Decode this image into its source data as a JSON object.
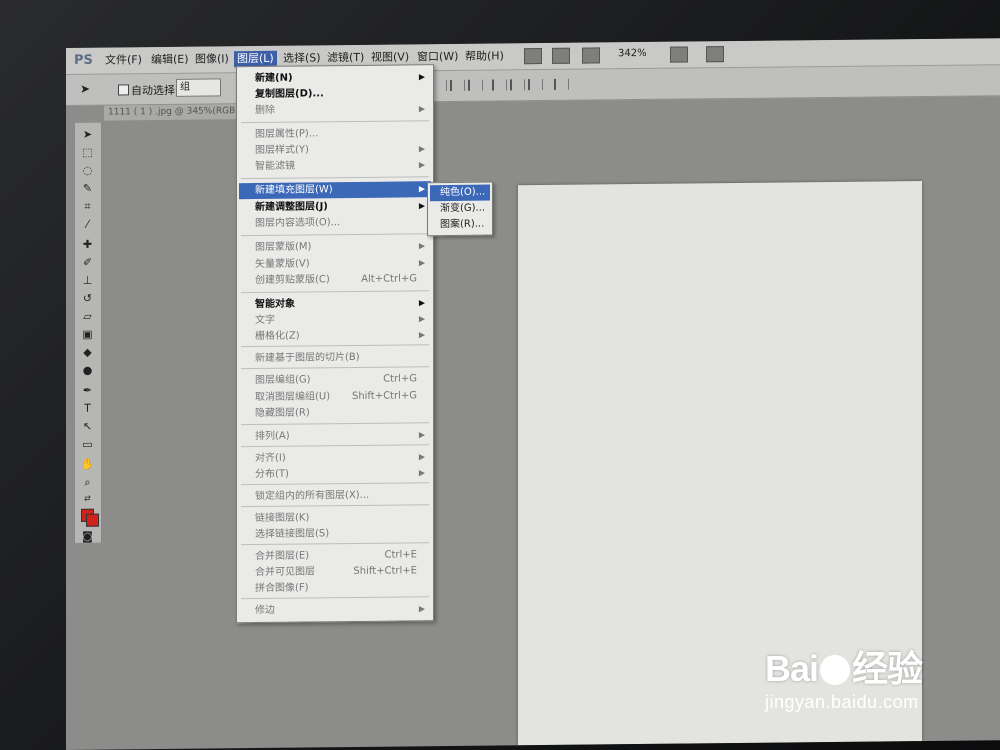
{
  "menubar": {
    "logo": "PS",
    "items": [
      "文件(F)",
      "编辑(E)",
      "图像(I)",
      "图层(L)",
      "选择(S)",
      "滤镜(T)",
      "视图(V)",
      "窗口(W)",
      "帮助(H)"
    ],
    "zoom": "342%"
  },
  "options_bar": {
    "auto_select_label": "自动选择:",
    "auto_select_value": "组"
  },
  "document_tab": "1111 ( 1 ) .jpg @ 345%(RGB",
  "layer_menu": {
    "items": [
      {
        "label": "新建(N)",
        "shortcut": "",
        "submenu": true,
        "state": "bold"
      },
      {
        "label": "复制图层(D)...",
        "shortcut": "",
        "submenu": false,
        "state": "bold"
      },
      {
        "label": "删除",
        "shortcut": "",
        "submenu": true,
        "state": "dim"
      },
      {
        "label": "图层属性(P)...",
        "shortcut": "",
        "submenu": false,
        "state": "dim"
      },
      {
        "label": "图层样式(Y)",
        "shortcut": "",
        "submenu": true,
        "state": "dim"
      },
      {
        "label": "智能滤镜",
        "shortcut": "",
        "submenu": true,
        "state": "dim"
      },
      {
        "label": "新建填充图层(W)",
        "shortcut": "",
        "submenu": true,
        "state": "highlight"
      },
      {
        "label": "新建调整图层(J)",
        "shortcut": "",
        "submenu": true,
        "state": "bold"
      },
      {
        "label": "图层内容选项(O)...",
        "shortcut": "",
        "submenu": false,
        "state": "dim"
      },
      {
        "label": "图层蒙版(M)",
        "shortcut": "",
        "submenu": true,
        "state": "dim"
      },
      {
        "label": "矢量蒙版(V)",
        "shortcut": "",
        "submenu": true,
        "state": "dim"
      },
      {
        "label": "创建剪贴蒙版(C)",
        "shortcut": "Alt+Ctrl+G",
        "submenu": false,
        "state": "dim"
      },
      {
        "label": "智能对象",
        "shortcut": "",
        "submenu": true,
        "state": "bold"
      },
      {
        "label": "文字",
        "shortcut": "",
        "submenu": true,
        "state": "dim"
      },
      {
        "label": "栅格化(Z)",
        "shortcut": "",
        "submenu": true,
        "state": "dim"
      },
      {
        "label": "新建基于图层的切片(B)",
        "shortcut": "",
        "submenu": false,
        "state": "dim"
      },
      {
        "label": "图层编组(G)",
        "shortcut": "Ctrl+G",
        "submenu": false,
        "state": "dim"
      },
      {
        "label": "取消图层编组(U)",
        "shortcut": "Shift+Ctrl+G",
        "submenu": false,
        "state": "dim"
      },
      {
        "label": "隐藏图层(R)",
        "shortcut": "",
        "submenu": false,
        "state": "dim"
      },
      {
        "label": "排列(A)",
        "shortcut": "",
        "submenu": true,
        "state": "dim"
      },
      {
        "label": "对齐(I)",
        "shortcut": "",
        "submenu": true,
        "state": "dim"
      },
      {
        "label": "分布(T)",
        "shortcut": "",
        "submenu": true,
        "state": "dim"
      },
      {
        "label": "锁定组内的所有图层(X)...",
        "shortcut": "",
        "submenu": false,
        "state": "dim"
      },
      {
        "label": "链接图层(K)",
        "shortcut": "",
        "submenu": false,
        "state": "dim"
      },
      {
        "label": "选择链接图层(S)",
        "shortcut": "",
        "submenu": false,
        "state": "dim"
      },
      {
        "label": "合并图层(E)",
        "shortcut": "Ctrl+E",
        "submenu": false,
        "state": "dim"
      },
      {
        "label": "合并可见图层",
        "shortcut": "Shift+Ctrl+E",
        "submenu": false,
        "state": "dim"
      },
      {
        "label": "拼合图像(F)",
        "shortcut": "",
        "submenu": false,
        "state": "dim"
      },
      {
        "label": "修边",
        "shortcut": "",
        "submenu": true,
        "state": "dim"
      }
    ]
  },
  "fill_submenu": {
    "items": [
      "纯色(O)...",
      "渐变(G)...",
      "图案(R)..."
    ]
  },
  "tools_panel": {
    "foreground_color": "#d0211c",
    "background_color": "#d0211c",
    "tool_icons": [
      "move-tool-icon",
      "marquee-tool-icon",
      "lasso-tool-icon",
      "quick-select-tool-icon",
      "crop-tool-icon",
      "eyedropper-tool-icon",
      "healing-brush-icon",
      "brush-tool-icon",
      "clone-stamp-icon",
      "history-brush-icon",
      "eraser-tool-icon",
      "gradient-tool-icon",
      "blur-tool-icon",
      "dodge-tool-icon",
      "pen-tool-icon",
      "type-tool-icon",
      "path-select-icon",
      "shape-tool-icon",
      "hand-tool-icon",
      "zoom-tool-icon"
    ]
  },
  "watermark": {
    "logo_left": "Bai",
    "logo_right": "经验",
    "url": "jingyan.baidu.com"
  }
}
